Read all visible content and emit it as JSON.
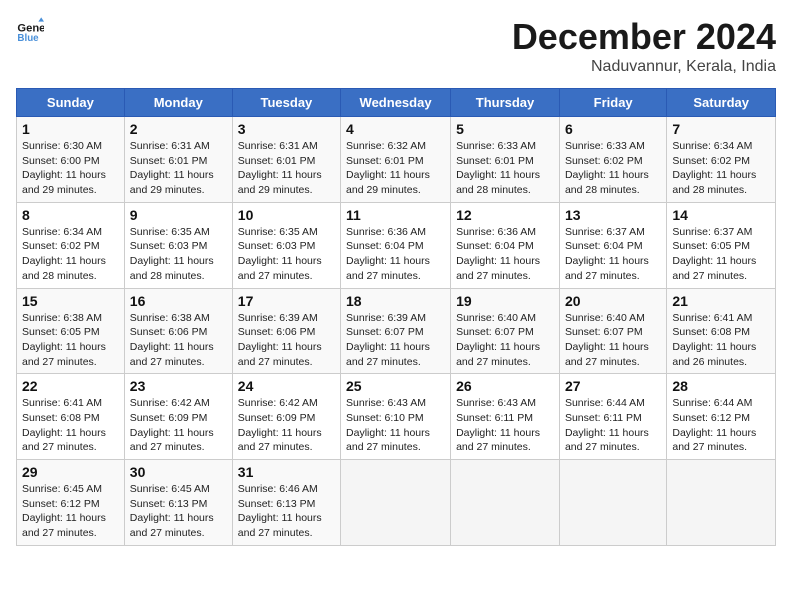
{
  "header": {
    "logo_line1": "General",
    "logo_line2": "Blue",
    "month": "December 2024",
    "location": "Naduvannur, Kerala, India"
  },
  "days_of_week": [
    "Sunday",
    "Monday",
    "Tuesday",
    "Wednesday",
    "Thursday",
    "Friday",
    "Saturday"
  ],
  "weeks": [
    [
      {
        "day": "1",
        "info": "Sunrise: 6:30 AM\nSunset: 6:00 PM\nDaylight: 11 hours\nand 29 minutes."
      },
      {
        "day": "2",
        "info": "Sunrise: 6:31 AM\nSunset: 6:01 PM\nDaylight: 11 hours\nand 29 minutes."
      },
      {
        "day": "3",
        "info": "Sunrise: 6:31 AM\nSunset: 6:01 PM\nDaylight: 11 hours\nand 29 minutes."
      },
      {
        "day": "4",
        "info": "Sunrise: 6:32 AM\nSunset: 6:01 PM\nDaylight: 11 hours\nand 29 minutes."
      },
      {
        "day": "5",
        "info": "Sunrise: 6:33 AM\nSunset: 6:01 PM\nDaylight: 11 hours\nand 28 minutes."
      },
      {
        "day": "6",
        "info": "Sunrise: 6:33 AM\nSunset: 6:02 PM\nDaylight: 11 hours\nand 28 minutes."
      },
      {
        "day": "7",
        "info": "Sunrise: 6:34 AM\nSunset: 6:02 PM\nDaylight: 11 hours\nand 28 minutes."
      }
    ],
    [
      {
        "day": "8",
        "info": "Sunrise: 6:34 AM\nSunset: 6:02 PM\nDaylight: 11 hours\nand 28 minutes."
      },
      {
        "day": "9",
        "info": "Sunrise: 6:35 AM\nSunset: 6:03 PM\nDaylight: 11 hours\nand 28 minutes."
      },
      {
        "day": "10",
        "info": "Sunrise: 6:35 AM\nSunset: 6:03 PM\nDaylight: 11 hours\nand 27 minutes."
      },
      {
        "day": "11",
        "info": "Sunrise: 6:36 AM\nSunset: 6:04 PM\nDaylight: 11 hours\nand 27 minutes."
      },
      {
        "day": "12",
        "info": "Sunrise: 6:36 AM\nSunset: 6:04 PM\nDaylight: 11 hours\nand 27 minutes."
      },
      {
        "day": "13",
        "info": "Sunrise: 6:37 AM\nSunset: 6:04 PM\nDaylight: 11 hours\nand 27 minutes."
      },
      {
        "day": "14",
        "info": "Sunrise: 6:37 AM\nSunset: 6:05 PM\nDaylight: 11 hours\nand 27 minutes."
      }
    ],
    [
      {
        "day": "15",
        "info": "Sunrise: 6:38 AM\nSunset: 6:05 PM\nDaylight: 11 hours\nand 27 minutes."
      },
      {
        "day": "16",
        "info": "Sunrise: 6:38 AM\nSunset: 6:06 PM\nDaylight: 11 hours\nand 27 minutes."
      },
      {
        "day": "17",
        "info": "Sunrise: 6:39 AM\nSunset: 6:06 PM\nDaylight: 11 hours\nand 27 minutes."
      },
      {
        "day": "18",
        "info": "Sunrise: 6:39 AM\nSunset: 6:07 PM\nDaylight: 11 hours\nand 27 minutes."
      },
      {
        "day": "19",
        "info": "Sunrise: 6:40 AM\nSunset: 6:07 PM\nDaylight: 11 hours\nand 27 minutes."
      },
      {
        "day": "20",
        "info": "Sunrise: 6:40 AM\nSunset: 6:07 PM\nDaylight: 11 hours\nand 27 minutes."
      },
      {
        "day": "21",
        "info": "Sunrise: 6:41 AM\nSunset: 6:08 PM\nDaylight: 11 hours\nand 26 minutes."
      }
    ],
    [
      {
        "day": "22",
        "info": "Sunrise: 6:41 AM\nSunset: 6:08 PM\nDaylight: 11 hours\nand 27 minutes."
      },
      {
        "day": "23",
        "info": "Sunrise: 6:42 AM\nSunset: 6:09 PM\nDaylight: 11 hours\nand 27 minutes."
      },
      {
        "day": "24",
        "info": "Sunrise: 6:42 AM\nSunset: 6:09 PM\nDaylight: 11 hours\nand 27 minutes."
      },
      {
        "day": "25",
        "info": "Sunrise: 6:43 AM\nSunset: 6:10 PM\nDaylight: 11 hours\nand 27 minutes."
      },
      {
        "day": "26",
        "info": "Sunrise: 6:43 AM\nSunset: 6:11 PM\nDaylight: 11 hours\nand 27 minutes."
      },
      {
        "day": "27",
        "info": "Sunrise: 6:44 AM\nSunset: 6:11 PM\nDaylight: 11 hours\nand 27 minutes."
      },
      {
        "day": "28",
        "info": "Sunrise: 6:44 AM\nSunset: 6:12 PM\nDaylight: 11 hours\nand 27 minutes."
      }
    ],
    [
      {
        "day": "29",
        "info": "Sunrise: 6:45 AM\nSunset: 6:12 PM\nDaylight: 11 hours\nand 27 minutes."
      },
      {
        "day": "30",
        "info": "Sunrise: 6:45 AM\nSunset: 6:13 PM\nDaylight: 11 hours\nand 27 minutes."
      },
      {
        "day": "31",
        "info": "Sunrise: 6:46 AM\nSunset: 6:13 PM\nDaylight: 11 hours\nand 27 minutes."
      },
      {
        "day": "",
        "info": ""
      },
      {
        "day": "",
        "info": ""
      },
      {
        "day": "",
        "info": ""
      },
      {
        "day": "",
        "info": ""
      }
    ]
  ]
}
